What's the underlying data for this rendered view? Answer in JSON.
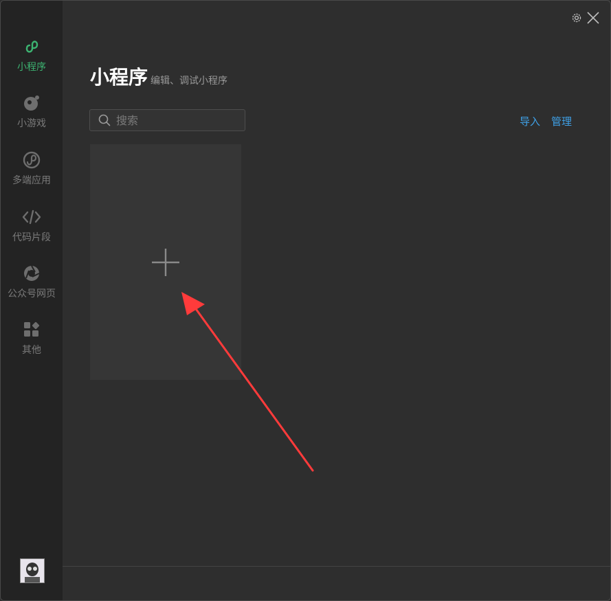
{
  "sidebar": {
    "items": [
      {
        "label": "小程序",
        "icon": "miniprogram-icon",
        "active": true
      },
      {
        "label": "小游戏",
        "icon": "minigame-icon",
        "active": false
      },
      {
        "label": "多端应用",
        "icon": "multiplatform-icon",
        "active": false
      },
      {
        "label": "代码片段",
        "icon": "code-snippet-icon",
        "active": false
      },
      {
        "label": "公众号网页",
        "icon": "official-account-icon",
        "active": false
      },
      {
        "label": "其他",
        "icon": "others-icon",
        "active": false
      }
    ],
    "active_color": "#3cb371"
  },
  "main": {
    "title": "小程序",
    "subtitle": "编辑、调试小程序",
    "search": {
      "placeholder": "搜索"
    },
    "actions": {
      "import_label": "导入",
      "manage_label": "管理"
    },
    "add_card_icon": "plus-icon",
    "link_color": "#3fa0e6"
  },
  "annotation": {
    "icon": "red-arrow-icon",
    "color": "#ff3b3b"
  }
}
